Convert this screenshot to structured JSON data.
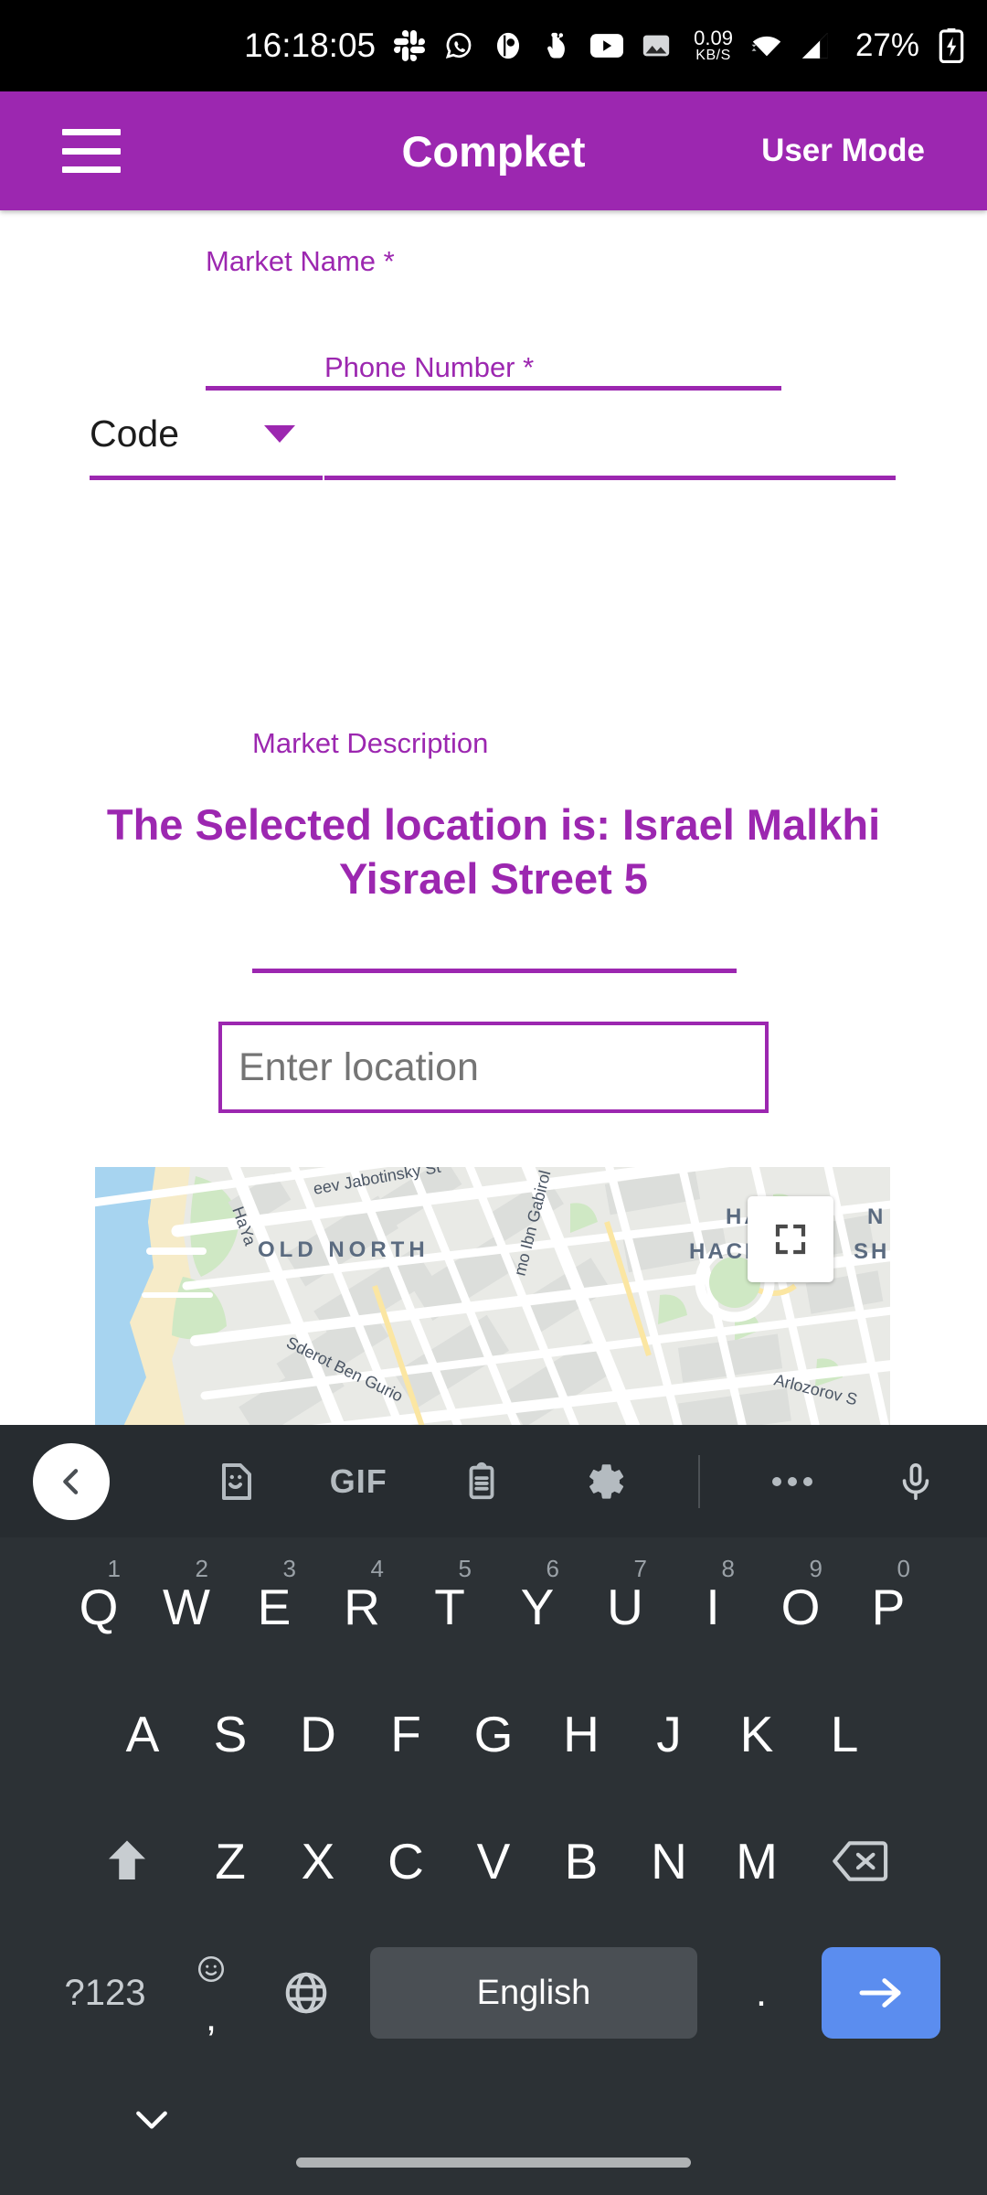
{
  "status_bar": {
    "time": "16:18:05",
    "network_speed": "0.09",
    "network_unit": "KB/S",
    "battery_percent": "27%",
    "icons": [
      "slack-icon",
      "whatsapp-icon",
      "app-notification-icon",
      "cursor-icon",
      "youtube-icon",
      "gallery-icon",
      "wifi-icon",
      "cellular-signal-icon",
      "battery-charging-icon"
    ]
  },
  "app_bar": {
    "menu_icon": "hamburger-menu-icon",
    "title": "Compket",
    "user_mode": "User Mode",
    "background_color": "#9c27b0"
  },
  "form": {
    "market_name_label": "Market Name *",
    "market_name_value": "",
    "code_label": "Code",
    "code_caret": "chevron-down-icon",
    "phone_label": "Phone Number *",
    "phone_value": "",
    "description_label": "Market Description",
    "description_value": ""
  },
  "location": {
    "selected_text": "The Selected location is: Israel Malkhi Yisrael Street 5",
    "input_placeholder": "Enter location",
    "input_value": "",
    "accent_color": "#9c27b0"
  },
  "map": {
    "fullscreen_icon": "fullscreen-expand-icon",
    "labels": [
      {
        "text": "OLD NORTH",
        "type": "neighborhood"
      },
      {
        "text": "Zeev Jabotinsky St",
        "type": "street"
      },
      {
        "text": "HaYarkon St",
        "type": "street"
      },
      {
        "text": "Shlomo Ibn Gabirol St",
        "type": "street"
      },
      {
        "text": "Sderot Ben Gurion",
        "type": "street"
      },
      {
        "text": "Arlozorov St",
        "type": "street"
      },
      {
        "text": "HAZ",
        "type": "neighborhood"
      },
      {
        "text": "HACH",
        "type": "neighborhood"
      },
      {
        "text": "N",
        "type": "neighborhood"
      },
      {
        "text": "SH",
        "type": "neighborhood"
      }
    ]
  },
  "keyboard": {
    "toolbar": [
      {
        "name": "back-chevron-icon",
        "label": ""
      },
      {
        "name": "sticker-icon",
        "label": ""
      },
      {
        "name": "gif-icon",
        "label": "GIF"
      },
      {
        "name": "clipboard-icon",
        "label": ""
      },
      {
        "name": "gear-icon",
        "label": ""
      },
      {
        "name": "more-options-icon",
        "label": ""
      },
      {
        "name": "microphone-icon",
        "label": ""
      }
    ],
    "row1": [
      {
        "key": "Q",
        "sup": "1"
      },
      {
        "key": "W",
        "sup": "2"
      },
      {
        "key": "E",
        "sup": "3"
      },
      {
        "key": "R",
        "sup": "4"
      },
      {
        "key": "T",
        "sup": "5"
      },
      {
        "key": "Y",
        "sup": "6"
      },
      {
        "key": "U",
        "sup": "7"
      },
      {
        "key": "I",
        "sup": "8"
      },
      {
        "key": "O",
        "sup": "9"
      },
      {
        "key": "P",
        "sup": "0"
      }
    ],
    "row2": [
      "A",
      "S",
      "D",
      "F",
      "G",
      "H",
      "J",
      "K",
      "L"
    ],
    "row3": [
      "Z",
      "X",
      "C",
      "V",
      "B",
      "N",
      "M"
    ],
    "shift_icon": "shift-up-arrow-icon",
    "backspace_icon": "backspace-delete-icon",
    "symbols_key": "?123",
    "comma_key": ",",
    "emoji_icon": "emoji-smiley-icon",
    "globe_icon": "language-globe-icon",
    "space_key": "English",
    "period_key": ".",
    "enter_icon": "enter-arrow-icon",
    "enter_color": "#5b8def",
    "nav_down_icon": "chevron-down-dismiss-icon",
    "home_indicator": "home-gesture-bar"
  }
}
